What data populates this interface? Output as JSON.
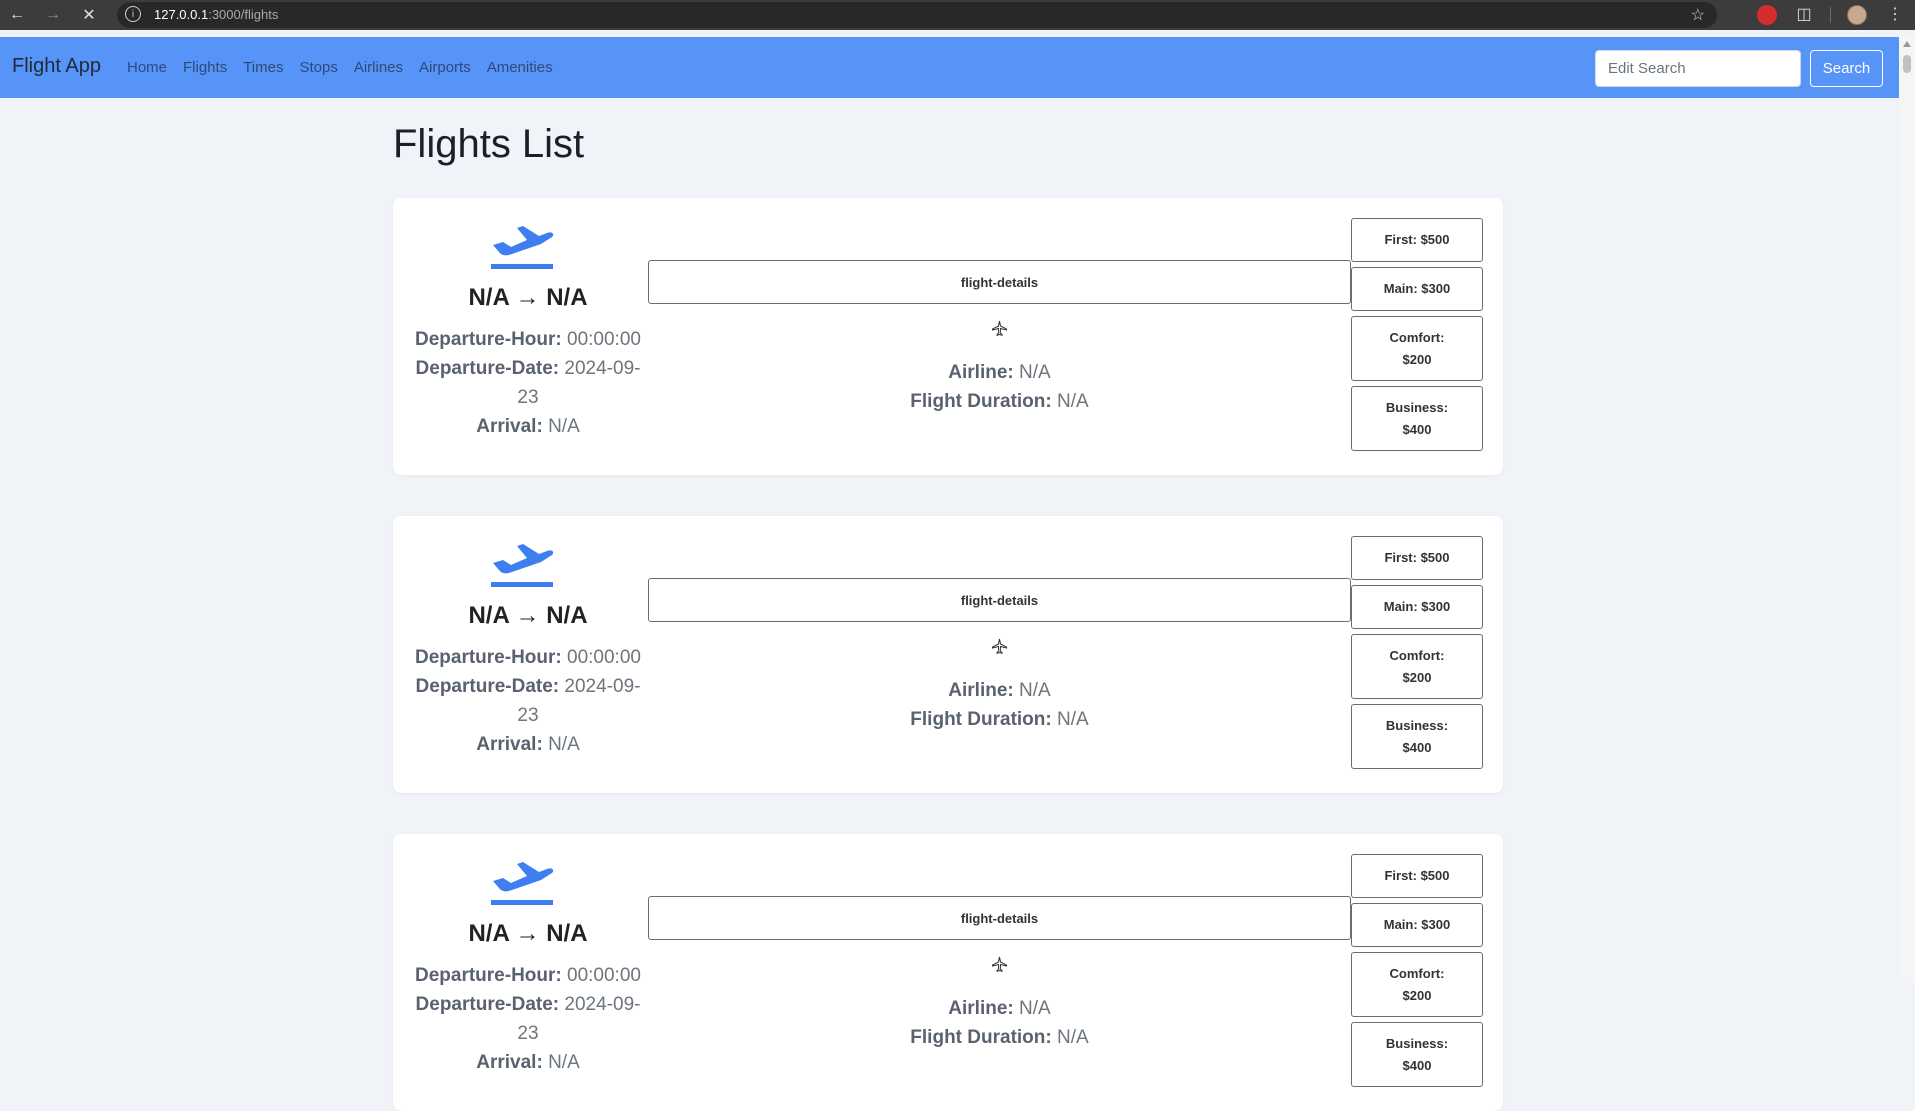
{
  "browser": {
    "url_host": "127.0.0.1",
    "url_path": ":3000/flights"
  },
  "navbar": {
    "brand": "Flight App",
    "links": [
      "Home",
      "Flights",
      "Times",
      "Stops",
      "Airlines",
      "Airports",
      "Amenities"
    ],
    "search_placeholder": "Edit Search",
    "search_button": "Search"
  },
  "page": {
    "title": "Flights List"
  },
  "labels": {
    "departure_hour": "Departure-Hour:",
    "departure_date": "Departure-Date:",
    "arrival": "Arrival:",
    "airline": "Airline:",
    "flight_duration": "Flight Duration:",
    "details_button": "flight-details"
  },
  "flights": [
    {
      "route": "N/A → N/A",
      "departure_hour": "00:00:00",
      "departure_date_a": "2024-09-",
      "departure_date_b": "23",
      "arrival": "N/A",
      "airline": "N/A",
      "duration": "N/A",
      "prices": [
        "First: $500",
        "Main: $300",
        "Comfort:",
        "$200",
        "Business:",
        "$400"
      ]
    },
    {
      "route": "N/A → N/A",
      "departure_hour": "00:00:00",
      "departure_date_a": "2024-09-",
      "departure_date_b": "23",
      "arrival": "N/A",
      "airline": "N/A",
      "duration": "N/A",
      "prices": [
        "First: $500",
        "Main: $300",
        "Comfort:",
        "$200",
        "Business:",
        "$400"
      ]
    },
    {
      "route": "N/A → N/A",
      "departure_hour": "00:00:00",
      "departure_date_a": "2024-09-",
      "departure_date_b": "23",
      "arrival": "N/A",
      "airline": "N/A",
      "duration": "N/A",
      "prices": [
        "First: $500",
        "Main: $300",
        "Comfort:",
        "$200",
        "Business:",
        "$400"
      ]
    }
  ]
}
